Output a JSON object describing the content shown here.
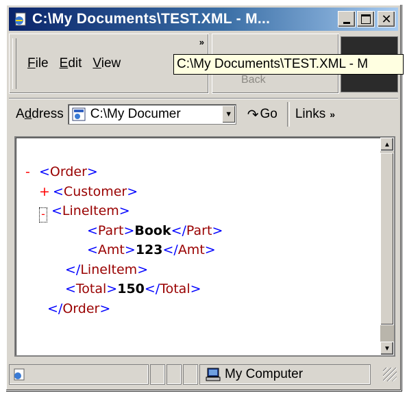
{
  "window": {
    "title": "C:\\My Documents\\TEST.XML - M...",
    "caption_buttons": [
      "minimize",
      "maximize",
      "close"
    ]
  },
  "menu": {
    "items": [
      {
        "label": "File",
        "key": "F",
        "rest": "ile"
      },
      {
        "label": "Edit",
        "key": "E",
        "rest": "dit"
      },
      {
        "label": "View",
        "key": "V",
        "rest": "iew"
      }
    ],
    "overflow": "»"
  },
  "toolbar": {
    "back_label": "Back",
    "tooltip": "C:\\My Documents\\TEST.XML - M"
  },
  "address": {
    "label": "Address",
    "label_key": "d",
    "value": "C:\\My Documer",
    "go_label": "Go",
    "links_label": "Links",
    "links_overflow": "»"
  },
  "xml": {
    "lines": [
      {
        "marker": "-",
        "open": "<",
        "tag": "Order",
        "close": ">"
      },
      {
        "marker": "+",
        "open": "<",
        "tag": "Customer",
        "close": ">"
      },
      {
        "marker": "-",
        "open": "<",
        "tag": "LineItem",
        "close": ">"
      },
      {
        "open": "<",
        "tag": "Part",
        "close": ">",
        "value": "Book",
        "end_open": "</",
        "end_tag": "Part",
        "end_close": ">"
      },
      {
        "open": "<",
        "tag": "Amt",
        "close": ">",
        "value": "123",
        "end_open": "</",
        "end_tag": "Amt",
        "end_close": ">"
      },
      {
        "open": "</",
        "tag": "LineItem",
        "close": ">"
      },
      {
        "open": "<",
        "tag": "Total",
        "close": ">",
        "value": "150",
        "end_open": "</",
        "end_tag": "Total",
        "end_close": ">"
      },
      {
        "open": "</",
        "tag": "Order",
        "close": ">"
      }
    ]
  },
  "status": {
    "zone": "My Computer"
  },
  "colors": {
    "title_bar": "#0a246a",
    "tag_name": "#990000",
    "bracket": "#0000ff",
    "marker": "#ff0000"
  },
  "icons": [
    "ie-page-icon",
    "minimize-icon",
    "maximize-icon",
    "close-icon",
    "xml-page-icon",
    "dropdown-arrow-icon",
    "go-arrow-icon",
    "computer-icon",
    "ie-status-icon",
    "resize-grip-icon"
  ]
}
